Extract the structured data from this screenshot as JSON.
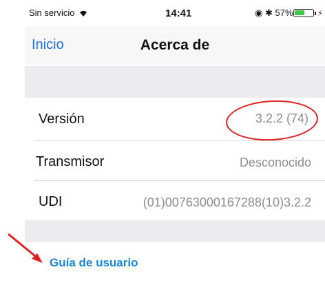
{
  "status_bar": {
    "carrier": "Sin servicio",
    "time": "14:41",
    "battery": "57%",
    "battery_level": 0.57
  },
  "nav": {
    "back_label": "Inicio",
    "title": "Acerca de"
  },
  "rows": [
    {
      "label": "Versión",
      "value": "3.2.2 (74)"
    },
    {
      "label": "Transmisor",
      "value": "Desconocido"
    },
    {
      "label": "UDI",
      "value": "(01)00763000167288(10)3.2.2"
    }
  ],
  "link": {
    "label": "Guía de usuario"
  },
  "annotation_colors": {
    "highlight": "#e02020",
    "link": "#1a84d8"
  }
}
